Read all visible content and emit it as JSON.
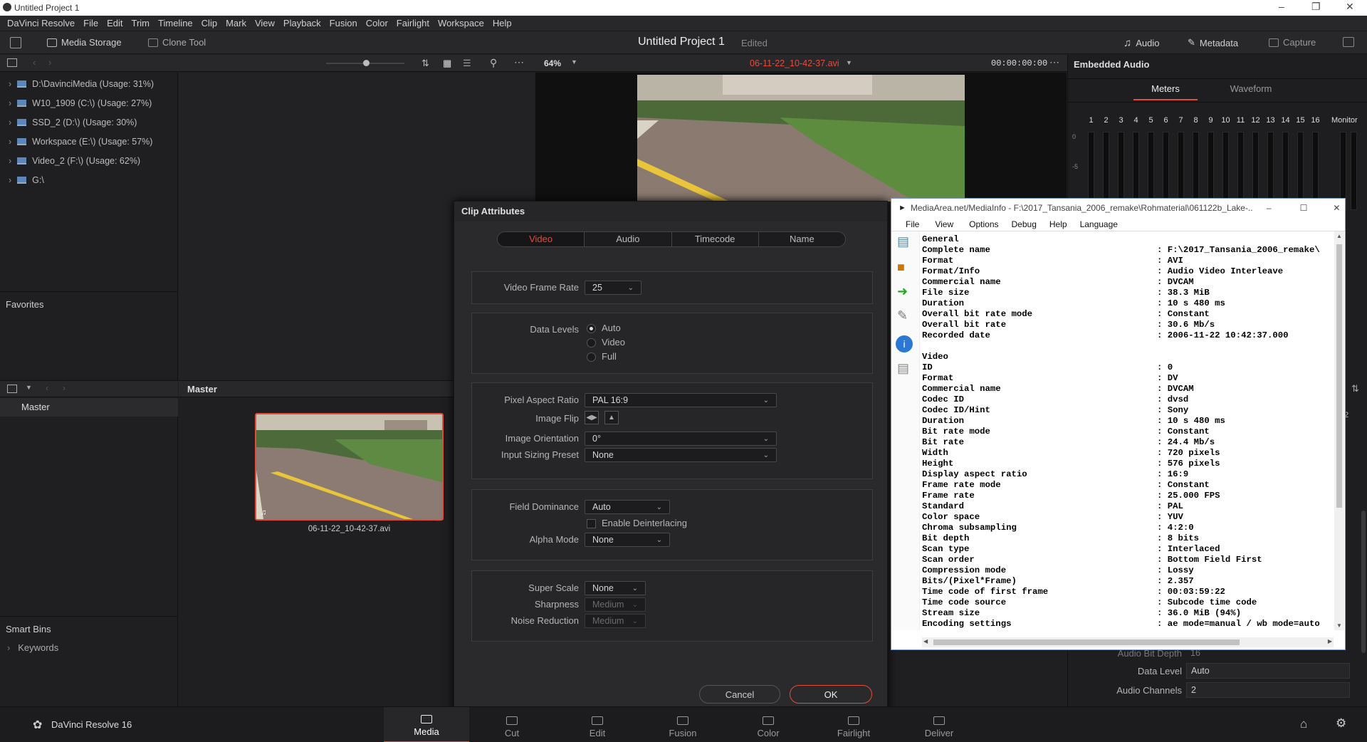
{
  "window": {
    "title": "Untitled Project 1"
  },
  "menu": [
    "DaVinci Resolve",
    "File",
    "Edit",
    "Trim",
    "Timeline",
    "Clip",
    "Mark",
    "View",
    "Playback",
    "Fusion",
    "Color",
    "Fairlight",
    "Workspace",
    "Help"
  ],
  "toolbar": {
    "media_storage": "Media Storage",
    "clone_tool": "Clone Tool",
    "project_name": "Untitled Project 1",
    "project_status": "Edited",
    "audio": "Audio",
    "metadata": "Metadata",
    "capture": "Capture"
  },
  "subtoolbar": {
    "zoom": "64%",
    "clip_name": "06-11-22_10-42-37.avi",
    "timecode": "00:00:00:00"
  },
  "volumes": [
    "D:\\DavinciMedia (Usage: 31%)",
    "W10_1909 (C:\\) (Usage: 27%)",
    "SSD_2 (D:\\) (Usage: 30%)",
    "Workspace (E:\\) (Usage: 57%)",
    "Video_2 (F:\\) (Usage: 62%)",
    "G:\\"
  ],
  "favorites": "Favorites",
  "bins": {
    "header": "Master",
    "master": "Master",
    "smart_bins": "Smart Bins",
    "keywords": "Keywords"
  },
  "thumbnail": {
    "name": "06-11-22_10-42-37.avi"
  },
  "right": {
    "title": "Embedded Audio",
    "tab_meters": "Meters",
    "tab_waveform": "Waveform",
    "channels": [
      "1",
      "2",
      "3",
      "4",
      "5",
      "6",
      "7",
      "8",
      "9",
      "10",
      "11",
      "12",
      "13",
      "14",
      "15",
      "16"
    ],
    "monitor": "Monitor",
    "scale": [
      "0",
      "-5",
      "-10"
    ],
    "audio_bit_depth_label": "Audio Bit Depth",
    "audio_bit_depth": "16",
    "data_level_label": "Data Level",
    "data_level": "Auto",
    "audio_channels_label": "Audio Channels",
    "audio_channels": "2",
    "side_value": "2"
  },
  "clip_attributes": {
    "title": "Clip Attributes",
    "tabs": [
      "Video",
      "Audio",
      "Timecode",
      "Name"
    ],
    "video_frame_rate_label": "Video Frame Rate",
    "video_frame_rate": "25",
    "data_levels_label": "Data Levels",
    "data_levels": [
      "Auto",
      "Video",
      "Full"
    ],
    "pixel_aspect_label": "Pixel Aspect Ratio",
    "pixel_aspect": "PAL 16:9",
    "image_flip_label": "Image Flip",
    "image_orientation_label": "Image Orientation",
    "image_orientation": "0°",
    "input_sizing_label": "Input Sizing Preset",
    "input_sizing": "None",
    "field_dominance_label": "Field Dominance",
    "field_dominance": "Auto",
    "enable_deinterlacing": "Enable Deinterlacing",
    "alpha_mode_label": "Alpha Mode",
    "alpha_mode": "None",
    "super_scale_label": "Super Scale",
    "super_scale": "None",
    "sharpness_label": "Sharpness",
    "sharpness": "Medium",
    "noise_reduction_label": "Noise Reduction",
    "noise_reduction": "Medium",
    "cancel": "Cancel",
    "ok": "OK"
  },
  "mediainfo": {
    "title": "MediaArea.net/MediaInfo - F:\\2017_Tansania_2006_remake\\Rohmaterial\\061122b_Lake-...",
    "menu": [
      "File",
      "View",
      "Options",
      "Debug",
      "Help",
      "Language"
    ],
    "rows": [
      [
        "General",
        ""
      ],
      [
        "Complete name",
        ": F:\\2017_Tansania_2006_remake\\"
      ],
      [
        "Format",
        ": AVI"
      ],
      [
        "Format/Info",
        ": Audio Video Interleave"
      ],
      [
        "Commercial name",
        ": DVCAM"
      ],
      [
        "File size",
        ": 38.3 MiB"
      ],
      [
        "Duration",
        ": 10 s 480 ms"
      ],
      [
        "Overall bit rate mode",
        ": Constant"
      ],
      [
        "Overall bit rate",
        ": 30.6 Mb/s"
      ],
      [
        "Recorded date",
        ": 2006-11-22 10:42:37.000"
      ],
      [
        "",
        ""
      ],
      [
        "Video",
        ""
      ],
      [
        "ID",
        ": 0"
      ],
      [
        "Format",
        ": DV"
      ],
      [
        "Commercial name",
        ": DVCAM"
      ],
      [
        "Codec ID",
        ": dvsd"
      ],
      [
        "Codec ID/Hint",
        ": Sony"
      ],
      [
        "Duration",
        ": 10 s 480 ms"
      ],
      [
        "Bit rate mode",
        ": Constant"
      ],
      [
        "Bit rate",
        ": 24.4 Mb/s"
      ],
      [
        "Width",
        ": 720 pixels"
      ],
      [
        "Height",
        ": 576 pixels"
      ],
      [
        "Display aspect ratio",
        ": 16:9"
      ],
      [
        "Frame rate mode",
        ": Constant"
      ],
      [
        "Frame rate",
        ": 25.000 FPS"
      ],
      [
        "Standard",
        ": PAL"
      ],
      [
        "Color space",
        ": YUV"
      ],
      [
        "Chroma subsampling",
        ": 4:2:0"
      ],
      [
        "Bit depth",
        ": 8 bits"
      ],
      [
        "Scan type",
        ": Interlaced"
      ],
      [
        "Scan order",
        ": Bottom Field First"
      ],
      [
        "Compression mode",
        ": Lossy"
      ],
      [
        "Bits/(Pixel*Frame)",
        ": 2.357"
      ],
      [
        "Time code of first frame",
        ": 00:03:59:22"
      ],
      [
        "Time code source",
        ": Subcode time code"
      ],
      [
        "Stream size",
        ": 36.0 MiB (94%)"
      ],
      [
        "Encoding settings",
        ": ae mode=manual / wb mode=auto"
      ]
    ]
  },
  "pages": [
    "Media",
    "Cut",
    "Edit",
    "Fusion",
    "Color",
    "Fairlight",
    "Deliver"
  ],
  "brand": "DaVinci Resolve 16",
  "colors": {
    "accent": "#e64b3c",
    "bg": "#1f1f21"
  }
}
